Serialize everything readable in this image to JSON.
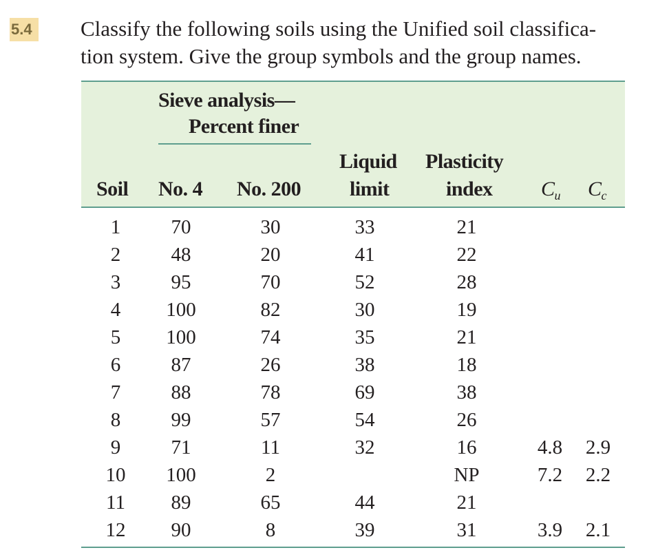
{
  "problem": {
    "number": "5.4",
    "text_line1": "Classify the following soils using the Unified soil classifica-",
    "text_line2": "tion system. Give the group symbols and the group names."
  },
  "table": {
    "headers": {
      "soil": "Soil",
      "sieve_group_line1": "Sieve analysis—",
      "sieve_group_line2": "Percent finer",
      "no4": "No. 4",
      "no200": "No. 200",
      "ll_line1": "Liquid",
      "ll_line2": "limit",
      "pi_line1": "Plasticity",
      "pi_line2": "index",
      "cu_base": "C",
      "cu_sub": "u",
      "cc_base": "C",
      "cc_sub": "c"
    },
    "rows": [
      {
        "soil": "1",
        "no4": "70",
        "no200": "30",
        "ll": "33",
        "pi": "21",
        "cu": "",
        "cc": ""
      },
      {
        "soil": "2",
        "no4": "48",
        "no200": "20",
        "ll": "41",
        "pi": "22",
        "cu": "",
        "cc": ""
      },
      {
        "soil": "3",
        "no4": "95",
        "no200": "70",
        "ll": "52",
        "pi": "28",
        "cu": "",
        "cc": ""
      },
      {
        "soil": "4",
        "no4": "100",
        "no200": "82",
        "ll": "30",
        "pi": "19",
        "cu": "",
        "cc": ""
      },
      {
        "soil": "5",
        "no4": "100",
        "no200": "74",
        "ll": "35",
        "pi": "21",
        "cu": "",
        "cc": ""
      },
      {
        "soil": "6",
        "no4": "87",
        "no200": "26",
        "ll": "38",
        "pi": "18",
        "cu": "",
        "cc": ""
      },
      {
        "soil": "7",
        "no4": "88",
        "no200": "78",
        "ll": "69",
        "pi": "38",
        "cu": "",
        "cc": ""
      },
      {
        "soil": "8",
        "no4": "99",
        "no200": "57",
        "ll": "54",
        "pi": "26",
        "cu": "",
        "cc": ""
      },
      {
        "soil": "9",
        "no4": "71",
        "no200": "11",
        "ll": "32",
        "pi": "16",
        "cu": "4.8",
        "cc": "2.9"
      },
      {
        "soil": "10",
        "no4": "100",
        "no200": "2",
        "ll": "",
        "pi": "NP",
        "cu": "7.2",
        "cc": "2.2"
      },
      {
        "soil": "11",
        "no4": "89",
        "no200": "65",
        "ll": "44",
        "pi": "21",
        "cu": "",
        "cc": ""
      },
      {
        "soil": "12",
        "no4": "90",
        "no200": "8",
        "ll": "39",
        "pi": "31",
        "cu": "3.9",
        "cc": "2.1"
      }
    ]
  },
  "colors": {
    "problem_number_bg": "#f6dfa6",
    "header_bg": "#e5f1dc",
    "rule": "#5e9e8e"
  }
}
